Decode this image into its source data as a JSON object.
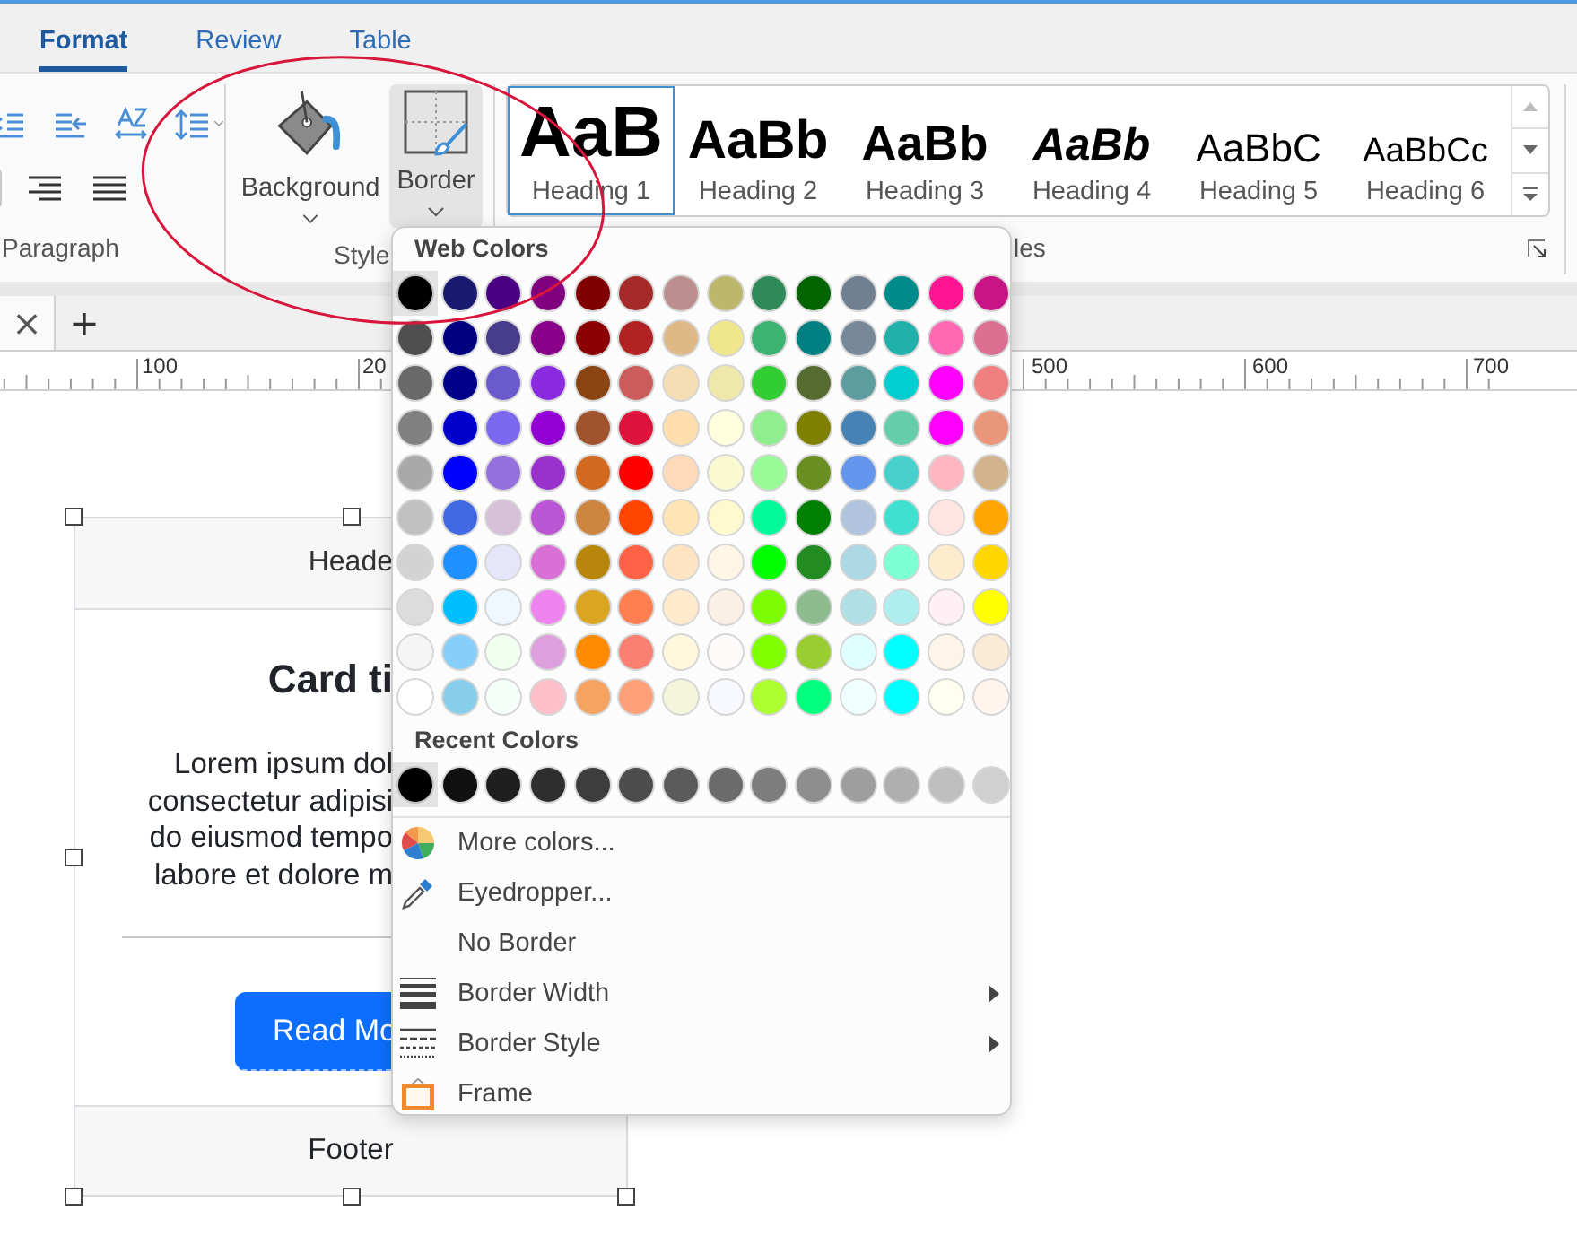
{
  "tabs": [
    {
      "label": "Format",
      "selected": true
    },
    {
      "label": "Review",
      "selected": false
    },
    {
      "label": "Table",
      "selected": false
    }
  ],
  "paragraph_group": {
    "label": "Paragraph",
    "align_buttons": [
      {
        "selected": true
      },
      {
        "selected": false
      },
      {
        "selected": false
      }
    ]
  },
  "style_group": {
    "label": "Style",
    "buttons": [
      {
        "label": "Background",
        "pressed": false
      },
      {
        "label": "Border",
        "pressed": true
      }
    ]
  },
  "gallery": {
    "label": "les",
    "items": [
      {
        "preview": "AaB",
        "name": "Heading 1",
        "selected": true
      },
      {
        "preview": "AaBb",
        "name": "Heading 2",
        "selected": false
      },
      {
        "preview": "AaBb",
        "name": "Heading 3",
        "selected": false
      },
      {
        "preview": "AaBb",
        "name": "Heading 4",
        "selected": false
      },
      {
        "preview": "AaBbC",
        "name": "Heading 5",
        "selected": false
      },
      {
        "preview": "AaBbCc",
        "name": "Heading 6",
        "selected": false
      }
    ]
  },
  "document_tabs": {
    "close": "×",
    "add": "+"
  },
  "ruler": {
    "labels": [
      "100",
      "20",
      "500",
      "600",
      "700"
    ]
  },
  "card": {
    "header": "Heade",
    "title": "Card ti",
    "body_lines": [
      "Lorem ipsum dol",
      "consectetur adipisi",
      "do eiusmod tempo",
      "labore et dolore m"
    ],
    "button": "Read Mo",
    "footer": "Footer"
  },
  "color_menu": {
    "web_title": "Web Colors",
    "recent_title": "Recent Colors",
    "web_colors": [
      {
        "color": "#000000",
        "selected": true
      },
      {
        "color": "#191970",
        "selected": false
      },
      {
        "color": "#4b0082",
        "selected": false
      },
      {
        "color": "#800080",
        "selected": false
      },
      {
        "color": "#800000",
        "selected": false
      },
      {
        "color": "#a52a2a",
        "selected": false
      },
      {
        "color": "#bc8f8f",
        "selected": false
      },
      {
        "color": "#bdb76b",
        "selected": false
      },
      {
        "color": "#2e8b57",
        "selected": false
      },
      {
        "color": "#006400",
        "selected": false
      },
      {
        "color": "#708090",
        "selected": false
      },
      {
        "color": "#008b8b",
        "selected": false
      },
      {
        "color": "#ff1493",
        "selected": false
      },
      {
        "color": "#c71585",
        "selected": false
      },
      {
        "color": "#4f4f4f",
        "selected": false
      },
      {
        "color": "#000080",
        "selected": false
      },
      {
        "color": "#483d8b",
        "selected": false
      },
      {
        "color": "#8b008b",
        "selected": false
      },
      {
        "color": "#8b0000",
        "selected": false
      },
      {
        "color": "#b22222",
        "selected": false
      },
      {
        "color": "#deb887",
        "selected": false
      },
      {
        "color": "#f0e68c",
        "selected": false
      },
      {
        "color": "#3cb371",
        "selected": false
      },
      {
        "color": "#008080",
        "selected": false
      },
      {
        "color": "#778899",
        "selected": false
      },
      {
        "color": "#20b2aa",
        "selected": false
      },
      {
        "color": "#ff69b4",
        "selected": false
      },
      {
        "color": "#db7093",
        "selected": false
      },
      {
        "color": "#696969",
        "selected": false
      },
      {
        "color": "#00008b",
        "selected": false
      },
      {
        "color": "#6a5acd",
        "selected": false
      },
      {
        "color": "#8a2be2",
        "selected": false
      },
      {
        "color": "#8b4513",
        "selected": false
      },
      {
        "color": "#cd5c5c",
        "selected": false
      },
      {
        "color": "#f5deb3",
        "selected": false
      },
      {
        "color": "#eee8aa",
        "selected": false
      },
      {
        "color": "#32cd32",
        "selected": false
      },
      {
        "color": "#556b2f",
        "selected": false
      },
      {
        "color": "#5f9ea0",
        "selected": false
      },
      {
        "color": "#00ced1",
        "selected": false
      },
      {
        "color": "#ff00ff",
        "selected": false
      },
      {
        "color": "#f08080",
        "selected": false
      },
      {
        "color": "#808080",
        "selected": false
      },
      {
        "color": "#0000cd",
        "selected": false
      },
      {
        "color": "#7b68ee",
        "selected": false
      },
      {
        "color": "#9400d3",
        "selected": false
      },
      {
        "color": "#a0522d",
        "selected": false
      },
      {
        "color": "#dc143c",
        "selected": false
      },
      {
        "color": "#ffdead",
        "selected": false
      },
      {
        "color": "#ffffe0",
        "selected": false
      },
      {
        "color": "#90ee90",
        "selected": false
      },
      {
        "color": "#808000",
        "selected": false
      },
      {
        "color": "#4682b4",
        "selected": false
      },
      {
        "color": "#66cdaa",
        "selected": false
      },
      {
        "color": "#ff00fe",
        "selected": false
      },
      {
        "color": "#e9967a",
        "selected": false
      },
      {
        "color": "#a9a9a9",
        "selected": false
      },
      {
        "color": "#0000ff",
        "selected": false
      },
      {
        "color": "#9370db",
        "selected": false
      },
      {
        "color": "#9932cc",
        "selected": false
      },
      {
        "color": "#d2691e",
        "selected": false
      },
      {
        "color": "#ff0000",
        "selected": false
      },
      {
        "color": "#ffdab9",
        "selected": false
      },
      {
        "color": "#fafad2",
        "selected": false
      },
      {
        "color": "#98fb98",
        "selected": false
      },
      {
        "color": "#6b8e23",
        "selected": false
      },
      {
        "color": "#6495ed",
        "selected": false
      },
      {
        "color": "#48d1cc",
        "selected": false
      },
      {
        "color": "#ffb6c1",
        "selected": false
      },
      {
        "color": "#d2b48c",
        "selected": false
      },
      {
        "color": "#c0c0c0",
        "selected": false
      },
      {
        "color": "#4169e1",
        "selected": false
      },
      {
        "color": "#d8bfd8",
        "selected": false
      },
      {
        "color": "#ba55d3",
        "selected": false
      },
      {
        "color": "#cd853f",
        "selected": false
      },
      {
        "color": "#ff4500",
        "selected": false
      },
      {
        "color": "#ffe4b5",
        "selected": false
      },
      {
        "color": "#fffacd",
        "selected": false
      },
      {
        "color": "#00fa9a",
        "selected": false
      },
      {
        "color": "#008000",
        "selected": false
      },
      {
        "color": "#b0c4de",
        "selected": false
      },
      {
        "color": "#40e0d0",
        "selected": false
      },
      {
        "color": "#ffe4e1",
        "selected": false
      },
      {
        "color": "#ffa500",
        "selected": false
      },
      {
        "color": "#d3d3d3",
        "selected": false
      },
      {
        "color": "#1e90ff",
        "selected": false
      },
      {
        "color": "#e6e6fa",
        "selected": false
      },
      {
        "color": "#da70d6",
        "selected": false
      },
      {
        "color": "#b8860b",
        "selected": false
      },
      {
        "color": "#ff6347",
        "selected": false
      },
      {
        "color": "#ffe4c4",
        "selected": false
      },
      {
        "color": "#fdf5e6",
        "selected": false
      },
      {
        "color": "#00ff00",
        "selected": false
      },
      {
        "color": "#228b22",
        "selected": false
      },
      {
        "color": "#add8e6",
        "selected": false
      },
      {
        "color": "#7fffd4",
        "selected": false
      },
      {
        "color": "#ffebcd",
        "selected": false
      },
      {
        "color": "#ffd700",
        "selected": false
      },
      {
        "color": "#dcdcdc",
        "selected": false
      },
      {
        "color": "#00bfff",
        "selected": false
      },
      {
        "color": "#f0f8ff",
        "selected": false
      },
      {
        "color": "#ee82ee",
        "selected": false
      },
      {
        "color": "#daa520",
        "selected": false
      },
      {
        "color": "#ff7f50",
        "selected": false
      },
      {
        "color": "#ffebcc",
        "selected": false
      },
      {
        "color": "#faf0e6",
        "selected": false
      },
      {
        "color": "#7cfc00",
        "selected": false
      },
      {
        "color": "#8fbc8f",
        "selected": false
      },
      {
        "color": "#b0e0e6",
        "selected": false
      },
      {
        "color": "#afeeee",
        "selected": false
      },
      {
        "color": "#fff0f5",
        "selected": false
      },
      {
        "color": "#ffff00",
        "selected": false
      },
      {
        "color": "#f5f5f5",
        "selected": false
      },
      {
        "color": "#87cefa",
        "selected": false
      },
      {
        "color": "#f0fff0",
        "selected": false
      },
      {
        "color": "#dda0dd",
        "selected": false
      },
      {
        "color": "#ff8c00",
        "selected": false
      },
      {
        "color": "#fa8072",
        "selected": false
      },
      {
        "color": "#fff8dc",
        "selected": false
      },
      {
        "color": "#fffafa",
        "selected": false
      },
      {
        "color": "#7fff00",
        "selected": false
      },
      {
        "color": "#9acd32",
        "selected": false
      },
      {
        "color": "#e0ffff",
        "selected": false
      },
      {
        "color": "#00ffff",
        "selected": false
      },
      {
        "color": "#fdf5e7",
        "selected": false
      },
      {
        "color": "#faebd7",
        "selected": false
      },
      {
        "color": "#ffffff",
        "selected": false
      },
      {
        "color": "#87ceeb",
        "selected": false
      },
      {
        "color": "#f5fffa",
        "selected": false
      },
      {
        "color": "#ffc0cb",
        "selected": false
      },
      {
        "color": "#f4a460",
        "selected": false
      },
      {
        "color": "#ffa07a",
        "selected": false
      },
      {
        "color": "#f5f5dc",
        "selected": false
      },
      {
        "color": "#f8f8ff",
        "selected": false
      },
      {
        "color": "#adff2f",
        "selected": false
      },
      {
        "color": "#00ff7f",
        "selected": false
      },
      {
        "color": "#f0ffff",
        "selected": false
      },
      {
        "color": "#00fffe",
        "selected": false
      },
      {
        "color": "#fffff0",
        "selected": false
      },
      {
        "color": "#fff5ee",
        "selected": false
      }
    ],
    "recent_colors": [
      {
        "color": "#000000",
        "selected": true
      },
      {
        "color": "#111111",
        "selected": false
      },
      {
        "color": "#1f1f1f",
        "selected": false
      },
      {
        "color": "#2e2e2e",
        "selected": false
      },
      {
        "color": "#3d3d3d",
        "selected": false
      },
      {
        "color": "#4c4c4c",
        "selected": false
      },
      {
        "color": "#5b5b5b",
        "selected": false
      },
      {
        "color": "#6b6b6b",
        "selected": false
      },
      {
        "color": "#7d7d7d",
        "selected": false
      },
      {
        "color": "#8e8e8e",
        "selected": false
      },
      {
        "color": "#9e9e9e",
        "selected": false
      },
      {
        "color": "#afafaf",
        "selected": false
      },
      {
        "color": "#bfbfbf",
        "selected": false
      },
      {
        "color": "#d0d0d0",
        "selected": false
      }
    ],
    "items": [
      {
        "kind": "wheel",
        "label": "More colors...",
        "submenu": false
      },
      {
        "kind": "eyedropper",
        "label": "Eyedropper...",
        "submenu": false
      },
      {
        "kind": "plain",
        "label": "No Border",
        "submenu": false
      },
      {
        "kind": "widths",
        "label": "Border Width",
        "submenu": true
      },
      {
        "kind": "styles",
        "label": "Border Style",
        "submenu": true
      },
      {
        "kind": "frame",
        "label": "Frame",
        "submenu": false
      }
    ]
  }
}
